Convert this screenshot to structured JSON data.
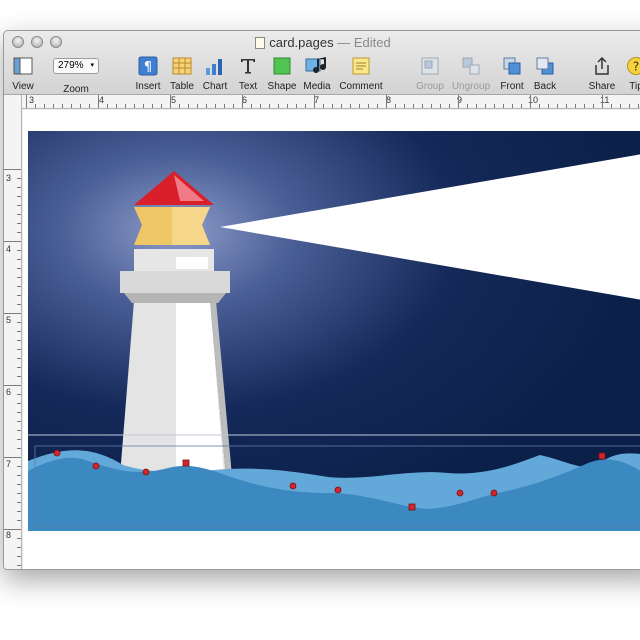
{
  "window": {
    "title": "card.pages",
    "separator": "—",
    "status": "Edited"
  },
  "toolbar": {
    "view": "View",
    "zoom_value": "279%",
    "zoom": "Zoom",
    "insert": "Insert",
    "table": "Table",
    "chart": "Chart",
    "text": "Text",
    "shape": "Shape",
    "media": "Media",
    "comment": "Comment",
    "group": "Group",
    "ungroup": "Ungroup",
    "front": "Front",
    "back": "Back",
    "share": "Share",
    "tips": "Tip"
  },
  "ruler": {
    "horizontal": [
      "3",
      "4",
      "5",
      "6",
      "7",
      "8",
      "9",
      "10",
      "11"
    ],
    "vertical": [
      "3",
      "4",
      "5",
      "6",
      "7",
      "8"
    ]
  },
  "colors": {
    "sky_dark": "#0c2350",
    "sky_glow": "#7f90c0",
    "beam": "#ffffff",
    "roof": "#d81f2a",
    "lamp": "#f0c766",
    "tower": "#e6e6e6",
    "wave_front": "#3c88c0",
    "wave_back": "#62a9d9",
    "handle": "#d2262a"
  },
  "icons": {
    "view": "sidebar-view-icon",
    "insert": "paragraph-icon",
    "table": "table-icon",
    "chart": "bar-chart-icon",
    "text": "text-t-icon",
    "shape": "square-shape-icon",
    "media": "music-note-icon",
    "comment": "comment-note-icon",
    "group": "group-icon",
    "ungroup": "ungroup-icon",
    "front": "bring-front-icon",
    "back": "send-back-icon",
    "share": "share-icon",
    "tips": "help-icon"
  }
}
